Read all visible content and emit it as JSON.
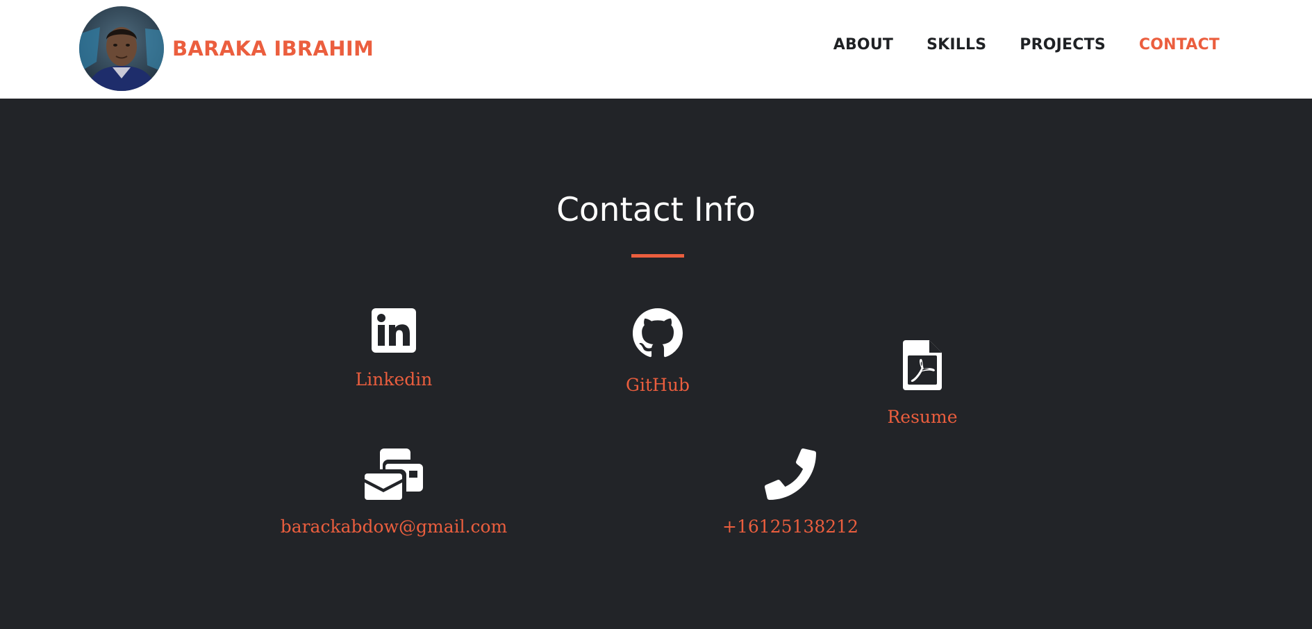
{
  "header": {
    "brand_name": "BARAKA IBRAHIM",
    "avatar_alt": "Profile photo",
    "nav": {
      "about": "ABOUT",
      "skills": "SKILLS",
      "projects": "PROJECTS",
      "contact": "CONTACT"
    },
    "active_nav": "contact"
  },
  "contact": {
    "title": "Contact Info",
    "items": {
      "linkedin": {
        "label": "Linkedin",
        "icon": "linkedin-icon"
      },
      "github": {
        "label": "GitHub",
        "icon": "github-icon"
      },
      "resume": {
        "label": "Resume",
        "icon": "pdf-file-icon"
      },
      "email": {
        "label": "barackabdow@gmail.com",
        "icon": "mail-bulk-icon"
      },
      "phone": {
        "label": "+16125138212",
        "icon": "phone-icon"
      }
    }
  },
  "colors": {
    "accent": "#eb5e3e",
    "background_dark": "#222428",
    "header_background": "#ffffff",
    "nav_text": "#1f2124",
    "icon_color": "#ffffff"
  }
}
